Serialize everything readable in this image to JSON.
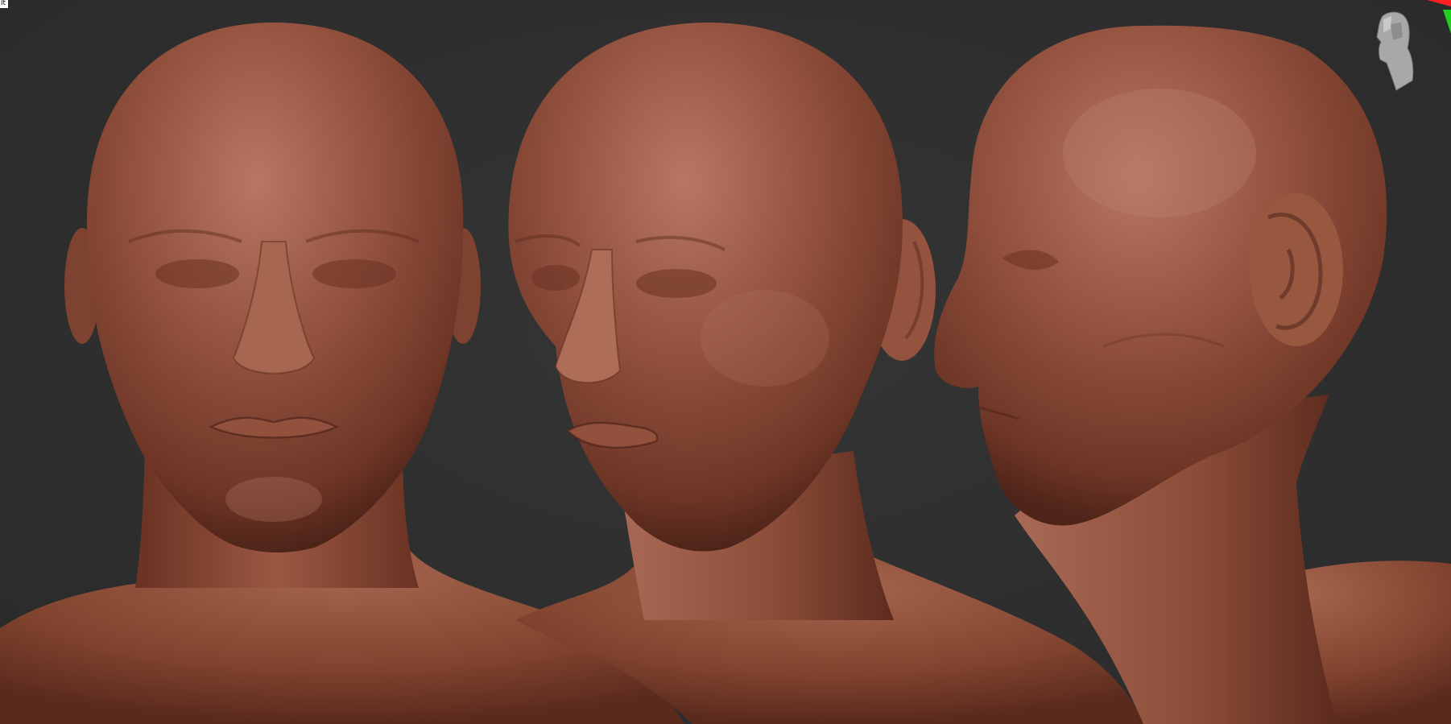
{
  "app": {
    "corner_label": "lt"
  },
  "viewport": {
    "background_color": "#2f2f2f",
    "clay_color": "#8a4a37",
    "clay_highlight": "#b5725c",
    "clay_shadow": "#4e2419"
  },
  "views": [
    {
      "name": "front-view"
    },
    {
      "name": "three-quarter-view"
    },
    {
      "name": "profile-view"
    }
  ],
  "navigator": {
    "icon": "head-navigator-icon",
    "axis_x_color": "#ff2020",
    "axis_y_color": "#20d020"
  }
}
